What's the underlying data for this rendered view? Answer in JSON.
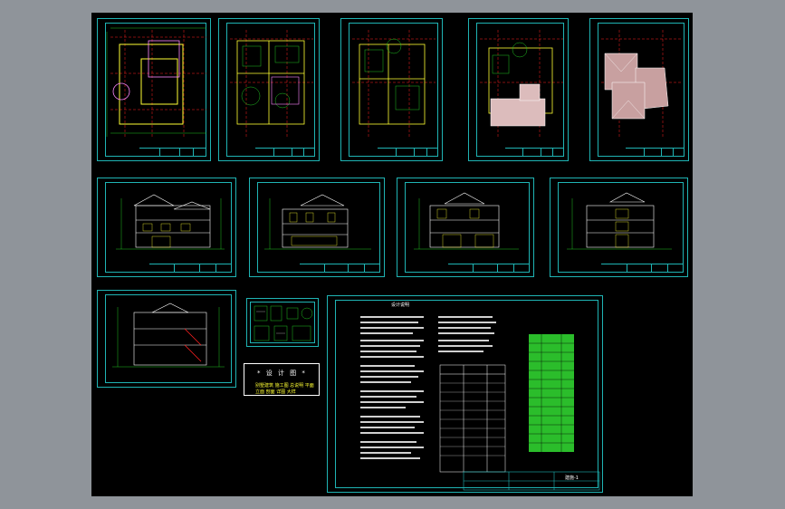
{
  "drawing": {
    "stamp": {
      "title": "* 设 计 图 *",
      "subtitle": "",
      "body": "别墅建筑 施工图 总说明 平面 立面 剖面 详图 大样"
    },
    "general_notes_title": "设计说明",
    "title_block_label": "建施-1"
  },
  "colors": {
    "background": "#8f949a",
    "model_space": "#000000",
    "frame": "#1fb4b4",
    "axis": "#ff2020",
    "wall": "#ffff33",
    "dim": "#20c020",
    "text": "#d0d0d0",
    "roof": "#c8a0a0",
    "table_green": "#2bbd2b"
  }
}
